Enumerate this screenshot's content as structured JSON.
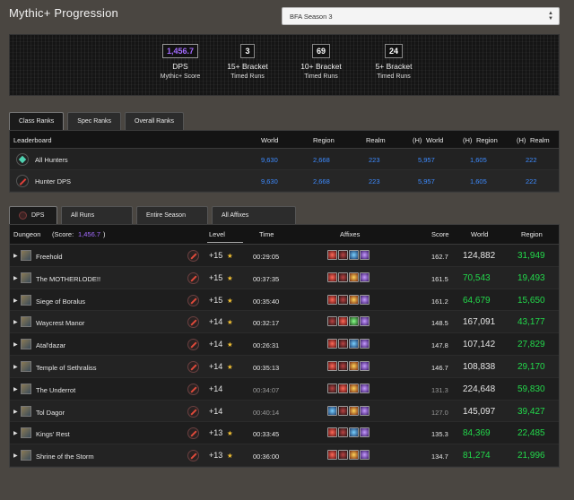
{
  "page": {
    "title": "Mythic+ Progression"
  },
  "season_select": {
    "value": "BFA Season 3"
  },
  "summary": {
    "stats": [
      {
        "value": "1,456.7",
        "label": "DPS",
        "sub": "Mythic+ Score"
      },
      {
        "value": "3",
        "label": "15+ Bracket",
        "sub": "Timed Runs"
      },
      {
        "value": "69",
        "label": "10+ Bracket",
        "sub": "Timed Runs"
      },
      {
        "value": "24",
        "label": "5+ Bracket",
        "sub": "Timed Runs"
      }
    ]
  },
  "rank_tabs": [
    "Class Ranks",
    "Spec Ranks",
    "Overall Ranks"
  ],
  "leaderboard": {
    "headers": [
      "Leaderboard",
      "World",
      "Region",
      "Realm",
      "(H)",
      "World",
      "(H)",
      "Region",
      "(H)",
      "Realm"
    ],
    "rows": [
      {
        "name": "All Hunters",
        "icon": "hunter-class-icon",
        "world": "9,630",
        "region": "2,668",
        "realm": "223",
        "h_world": "5,957",
        "h_region": "1,605",
        "h_realm": "222"
      },
      {
        "name": "Hunter DPS",
        "icon": "dps-spec-icon",
        "world": "9,630",
        "region": "2,668",
        "realm": "223",
        "h_world": "5,957",
        "h_region": "1,605",
        "h_realm": "222"
      }
    ]
  },
  "run_tabs": [
    "DPS",
    "All Runs",
    "Entire Season",
    "All Affixes"
  ],
  "dungeons": {
    "headers": {
      "dungeon": "Dungeon",
      "score_prefix": "(Score:",
      "score_value": "1,456.7",
      "score_suffix": ")",
      "level": "Level",
      "time": "Time",
      "affixes": "Affixes",
      "score": "Score",
      "world": "World",
      "region": "Region"
    },
    "rows": [
      {
        "name": "Freehold",
        "level": "+15",
        "stars": "★",
        "time": "00:29:05",
        "affixes": [
          "red",
          "dark",
          "blue",
          "purple"
        ],
        "score": "162.7",
        "world": "124,882",
        "region": "31,949",
        "world_color": "white"
      },
      {
        "name": "The MOTHERLODE!!",
        "level": "+15",
        "stars": "★",
        "time": "00:37:35",
        "affixes": [
          "red",
          "dark",
          "fire",
          "purple"
        ],
        "score": "161.5",
        "world": "70,543",
        "region": "19,493",
        "world_color": "green"
      },
      {
        "name": "Siege of Boralus",
        "level": "+15",
        "stars": "★",
        "time": "00:35:40",
        "affixes": [
          "red",
          "dark",
          "fire",
          "purple"
        ],
        "score": "161.2",
        "world": "64,679",
        "region": "15,650",
        "world_color": "green"
      },
      {
        "name": "Waycrest Manor",
        "level": "+14",
        "stars": "★",
        "time": "00:32:17",
        "affixes": [
          "dark",
          "red",
          "green",
          "purple"
        ],
        "score": "148.5",
        "world": "167,091",
        "region": "43,177",
        "world_color": "white"
      },
      {
        "name": "Atal'dazar",
        "level": "+14",
        "stars": "★",
        "time": "00:26:31",
        "affixes": [
          "red",
          "dark",
          "blue",
          "purple"
        ],
        "score": "147.8",
        "world": "107,142",
        "region": "27,829",
        "world_color": "white"
      },
      {
        "name": "Temple of Sethraliss",
        "level": "+14",
        "stars": "★",
        "time": "00:35:13",
        "affixes": [
          "red",
          "dark",
          "fire",
          "purple"
        ],
        "score": "146.7",
        "world": "108,838",
        "region": "29,170",
        "world_color": "white"
      },
      {
        "name": "The Underrot",
        "level": "+14",
        "stars": "",
        "time": "00:34:07",
        "affixes": [
          "dark",
          "red",
          "fire",
          "purple"
        ],
        "score": "131.3",
        "world": "224,648",
        "region": "59,830",
        "world_color": "white",
        "depleted": true
      },
      {
        "name": "Tol Dagor",
        "level": "+14",
        "stars": "",
        "time": "00:40:14",
        "affixes": [
          "blue",
          "dark",
          "fire",
          "purple"
        ],
        "score": "127.0",
        "world": "145,097",
        "region": "39,427",
        "world_color": "white",
        "depleted": true
      },
      {
        "name": "Kings' Rest",
        "level": "+13",
        "stars": "★",
        "time": "00:33:45",
        "affixes": [
          "red",
          "dark",
          "blue",
          "purple"
        ],
        "score": "135.3",
        "world": "84,369",
        "region": "22,485",
        "world_color": "green"
      },
      {
        "name": "Shrine of the Storm",
        "level": "+13",
        "stars": "★",
        "time": "00:36:00",
        "affixes": [
          "red",
          "dark",
          "fire",
          "purple"
        ],
        "score": "134.7",
        "world": "81,274",
        "region": "21,996",
        "world_color": "green"
      }
    ]
  }
}
